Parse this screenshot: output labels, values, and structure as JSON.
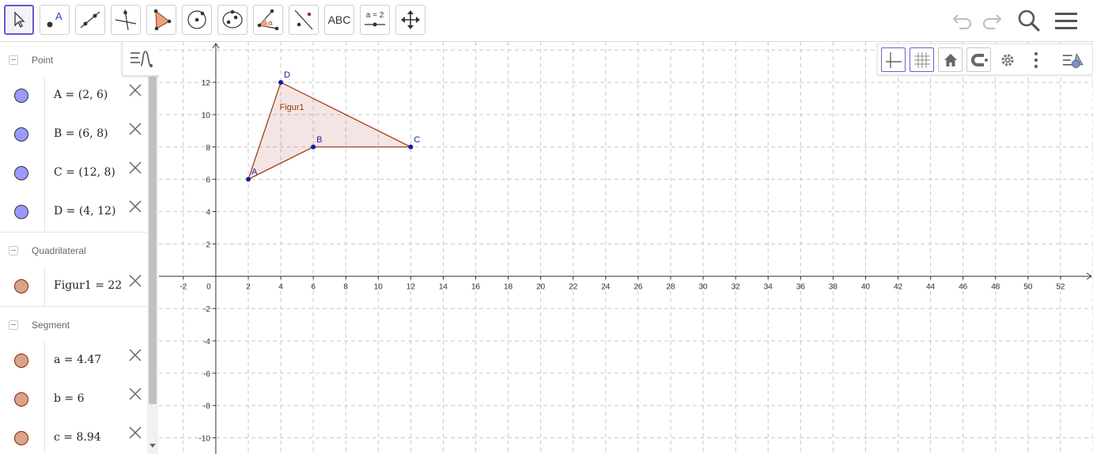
{
  "toolbar": {
    "tools": [
      {
        "name": "move-tool",
        "icon": "arrow-cursor-icon",
        "selected": true
      },
      {
        "name": "point-tool",
        "icon": "point-a-icon",
        "label": "A"
      },
      {
        "name": "line-tool",
        "icon": "line-icon"
      },
      {
        "name": "perpendicular-tool",
        "icon": "perpendicular-line-icon"
      },
      {
        "name": "polygon-tool",
        "icon": "polygon-icon"
      },
      {
        "name": "circle-tool",
        "icon": "circle-center-point-icon"
      },
      {
        "name": "conic-tool",
        "icon": "ellipse-icon"
      },
      {
        "name": "angle-tool",
        "icon": "angle-icon",
        "label": "α"
      },
      {
        "name": "reflect-tool",
        "icon": "reflect-about-line-icon"
      },
      {
        "name": "text-tool",
        "icon": "text-icon",
        "label": "ABC"
      },
      {
        "name": "slider-tool",
        "icon": "slider-icon",
        "label": "a = 2"
      },
      {
        "name": "move-graphics-tool",
        "icon": "move-cross-icon"
      }
    ],
    "right": [
      "undo-icon",
      "redo-icon",
      "search-icon",
      "menu-icon"
    ]
  },
  "algebra": {
    "groups": [
      {
        "label": "Point",
        "items": [
          {
            "text": "A = (2, 6)",
            "color": "#9999ff"
          },
          {
            "text": "B = (6, 8)",
            "color": "#9999ff"
          },
          {
            "text": "C = (12, 8)",
            "color": "#9999ff"
          },
          {
            "text": "D = (4, 12)",
            "color": "#9999ff"
          }
        ]
      },
      {
        "label": "Quadrilateral",
        "items": [
          {
            "text": "Figur1 = 22",
            "color": "#d9a38c"
          }
        ]
      },
      {
        "label": "Segment",
        "items": [
          {
            "text": "a = 4.47",
            "color": "#d9a38c"
          },
          {
            "text": "b = 6",
            "color": "#d9a38c"
          },
          {
            "text": "c = 8.94",
            "color": "#d9a38c"
          }
        ]
      }
    ]
  },
  "graphics": {
    "x_range": [
      -3.5,
      54
    ],
    "y_range": [
      -11,
      14.5
    ],
    "x_ticks": [
      "-2",
      "0",
      "2",
      "4",
      "6",
      "8",
      "10",
      "12",
      "14",
      "16",
      "18",
      "20",
      "22",
      "24",
      "26",
      "28",
      "30",
      "32",
      "34",
      "36",
      "38",
      "40",
      "42",
      "44",
      "46",
      "48",
      "50",
      "52"
    ],
    "y_ticks": [
      "12",
      "10",
      "8",
      "6",
      "4",
      "2",
      "-2",
      "-4",
      "-6",
      "-8",
      "-10"
    ],
    "polygon": {
      "label": "Figur1",
      "order": [
        "A",
        "B",
        "C",
        "D"
      ],
      "fill": "#a52a2a",
      "stroke": "#993300"
    },
    "points": [
      {
        "name": "A",
        "x": 2,
        "y": 6
      },
      {
        "name": "B",
        "x": 6,
        "y": 8
      },
      {
        "name": "C",
        "x": 12,
        "y": 8
      },
      {
        "name": "D",
        "x": 4,
        "y": 12
      }
    ],
    "point_color": "#1a1aa0",
    "style_bar": [
      "axes-toggle-icon",
      "grid-toggle-icon",
      "home-icon",
      "point-capture-icon",
      "settings-icon",
      "more-vert-icon",
      "graphics-style-icon"
    ]
  }
}
